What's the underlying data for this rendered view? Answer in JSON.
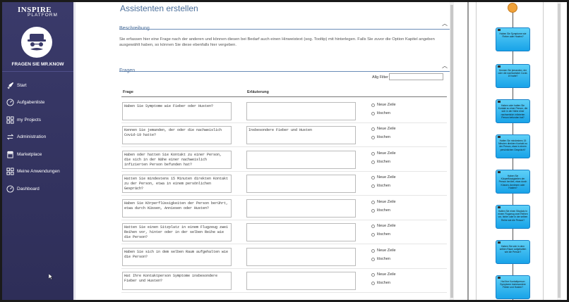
{
  "brand": {
    "name": "INSPIRE",
    "sub": "PLATFORM"
  },
  "user": {
    "name": "FRAGEN SIE MR.KNOW"
  },
  "nav": [
    {
      "label": "Start",
      "icon": "rocket-icon"
    },
    {
      "label": "Aufgabenliste",
      "icon": "gauge-icon"
    },
    {
      "label": "my Projects",
      "icon": "grid-icon"
    },
    {
      "label": "Administration",
      "icon": "cycle-icon"
    },
    {
      "label": "Marketplace",
      "icon": "store-icon"
    },
    {
      "label": "Meine Anwendungen",
      "icon": "grid-icon"
    },
    {
      "label": "Dashboard",
      "icon": "gauge-icon"
    }
  ],
  "page": {
    "title": "Assistenten erstellen",
    "section1": "Beschreibung",
    "description": "Sie erfassen hier eine Frage nach der anderen und können diesen bei Bedarf auch einen Hinweistext (sog. Tooltip) mit hinterlegen. Falls Sie zuvor die Option Kapitel angeben ausgewählt haben, so können Sie diese ebenfalls hier vergeben.",
    "section2": "Fragen",
    "filter_label": "Allg Filter",
    "filter_value": "",
    "col_frage": "Frage",
    "col_erl": "Erläuterung",
    "action_new": "Neue Zeile",
    "action_delete": "löschen"
  },
  "questions": [
    {
      "frage": "Haben Sie Symptome wie Fieber oder Husten?",
      "erl": ""
    },
    {
      "frage": "Kennen Sie jemanden, der oder die nachweislich Covid-19 hatte?",
      "erl": "Insbesondere Fieber und Husten"
    },
    {
      "frage": "Haben oder hatten Sie Kontakt zu einer Person, die sich in der Nähe einer nachweislich infizierten Person befunden hat?",
      "erl": ""
    },
    {
      "frage": "Hatten Sie mindestens 15 Minuten direkten Kontakt zu der Person, etwa in einem persönlichen Gespräch?",
      "erl": ""
    },
    {
      "frage": "Haben Sie Körperflüssigkeiten der Person berührt, etwa durch Küssen, Anniesen oder Husten?",
      "erl": ""
    },
    {
      "frage": "Hatten Sie einen Sitzplatz in einem Flugzeug zwei Reihen vor, hinter oder in der selben Reihe wie die Person?",
      "erl": ""
    },
    {
      "frage": "Haben Sie sich in dem selben Raum aufgehalten wie die Person?",
      "erl": ""
    },
    {
      "frage": "Hat Ihre Kontaktperson Symptome insbesondere Fieber und Husten?",
      "erl": ""
    }
  ],
  "flow": [
    "Haben Sie Symptome wie Fieber oder Husten?",
    "Kennen Sie jemanden, der oder die nachweislich Covid-19 hatte?",
    "Haben oder hatten Sie Kontakt zu einer Person, die sich in der Nähe einer nachweislich infizierten Person befunden hat?",
    "Hatten Sie mindestens 15 Minuten direkten Kontakt zu der Person, etwa in einem persönlichen Gespräch?",
    "Haben Sie Körperflüssigkeiten der Person berührt, etwa durch Küssen, Anniesen oder Husten?",
    "Hatten Sie einen Sitzplatz in einem Flugzeug zwei Reihen vor, hinter oder in der selben Reihe wie die Person?",
    "Haben Sie sich in dem selben Raum aufgehalten wie die Person?",
    "Hat Ihre Kontaktperson Symptome insbesondere Fieber und Husten?"
  ]
}
